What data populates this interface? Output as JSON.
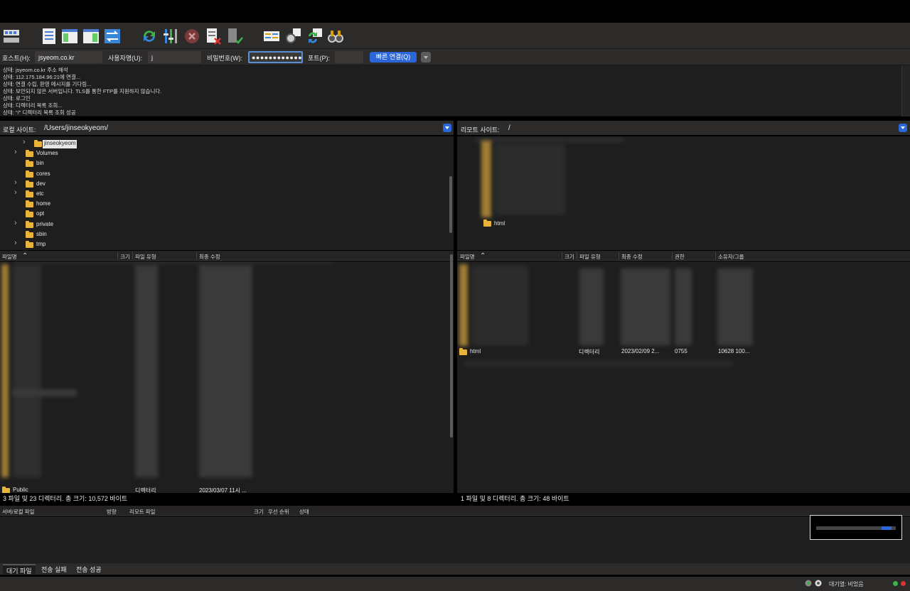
{
  "quickconnect": {
    "host_label": "호스트(H):",
    "host_value": "jsyeom.co.kr",
    "user_label": "사용자명(U):",
    "user_value": "j",
    "pass_label": "비밀번호(W):",
    "pass_value": "●●●●●●●●●●●●",
    "port_label": "포트(P):",
    "port_value": "",
    "connect_label": "빠른 연결(Q)"
  },
  "log": [
    "상태:  jsyeom.co.kr 주소 해석",
    "상태:  112.175.184.96:21에 연결...",
    "상태:  연결 수립, 환영 메시지를 기다림...",
    "상태:  보안되지 않은 서버입니다. TLS를 통한 FTP를 지원하지 않습니다.",
    "상태:  로그인",
    "상태:  디렉터리 목록 조회...",
    "상태:  \"/\" 디렉터리 목록 조회 성공"
  ],
  "local": {
    "label": "로컬 사이트:",
    "path": "/Users/jinseokyeom/",
    "tree": [
      {
        "name": "jinseokyeom",
        "chev": true,
        "selected": true
      },
      {
        "name": "Volumes",
        "chev": true
      },
      {
        "name": "bin",
        "chev": false
      },
      {
        "name": "cores",
        "chev": false
      },
      {
        "name": "dev",
        "chev": true
      },
      {
        "name": "etc",
        "chev": true
      },
      {
        "name": "home",
        "chev": false
      },
      {
        "name": "opt",
        "chev": false
      },
      {
        "name": "private",
        "chev": true
      },
      {
        "name": "sbin",
        "chev": false
      },
      {
        "name": "tmp",
        "chev": true
      }
    ],
    "columns": [
      "파일명",
      "크기",
      "파일 유형",
      "최종 수정"
    ],
    "last_row": {
      "name": "Public",
      "type": "디렉터리",
      "modified": "2023/03/07 11시 ..."
    },
    "status": "3 파일 및 23 디렉터리. 총 크기: 10,572 바이트"
  },
  "remote": {
    "label": "리모트 사이트:",
    "path": "/",
    "tree_item": "html",
    "columns": [
      "파일명",
      "크기",
      "파일 유형",
      "최종 수정",
      "권한",
      "소유자/그룹"
    ],
    "row": {
      "name": "html",
      "size": "",
      "type": "디렉터리",
      "modified": "2023/02/09 2...",
      "perm": "0755",
      "owner": "10628 100..."
    },
    "status": "1 파일 및 8 디렉터리. 총 크기: 48 바이트"
  },
  "queue": {
    "columns": [
      "서버/로컬 파일",
      "방향",
      "리모트 파일",
      "크기",
      "우선 순위",
      "상태"
    ],
    "tabs": [
      "대기 파일",
      "전송 실패",
      "전송 성공"
    ],
    "status": "대기열: 비었음"
  }
}
